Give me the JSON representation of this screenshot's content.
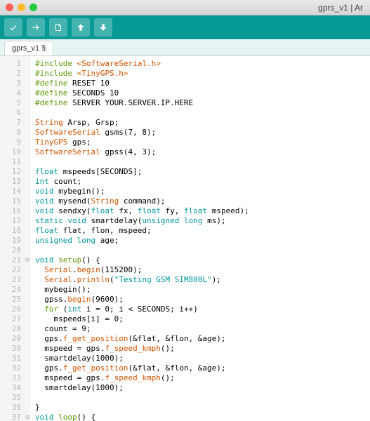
{
  "window": {
    "title": "gprs_v1 | Ar"
  },
  "toolbar": {
    "verify_icon": "verify",
    "upload_icon": "upload",
    "new_icon": "new",
    "open_icon": "open",
    "save_icon": "save"
  },
  "tab": {
    "label": "gprs_v1 §"
  },
  "lines": [
    {
      "n": "1",
      "fold": "",
      "segs": [
        {
          "c": "kw-green",
          "t": "#include"
        },
        {
          "c": "",
          "t": " "
        },
        {
          "c": "kw-orange",
          "t": "<SoftwareSerial.h>"
        }
      ]
    },
    {
      "n": "2",
      "fold": "",
      "segs": [
        {
          "c": "kw-green",
          "t": "#include"
        },
        {
          "c": "",
          "t": " "
        },
        {
          "c": "kw-orange",
          "t": "<TinyGPS.h>"
        }
      ]
    },
    {
      "n": "3",
      "fold": "",
      "segs": [
        {
          "c": "kw-green",
          "t": "#define"
        },
        {
          "c": "",
          "t": " RESET 10"
        }
      ]
    },
    {
      "n": "4",
      "fold": "",
      "segs": [
        {
          "c": "kw-green",
          "t": "#define"
        },
        {
          "c": "",
          "t": " SECONDS 10"
        }
      ]
    },
    {
      "n": "5",
      "fold": "",
      "segs": [
        {
          "c": "kw-green",
          "t": "#define"
        },
        {
          "c": "",
          "t": " SERVER YOUR.SERVER.IP.HERE"
        }
      ]
    },
    {
      "n": "6",
      "fold": "",
      "segs": [
        {
          "c": "",
          "t": ""
        }
      ]
    },
    {
      "n": "7",
      "fold": "",
      "segs": [
        {
          "c": "kw-orange",
          "t": "String"
        },
        {
          "c": "",
          "t": " Arsp, Grsp;"
        }
      ]
    },
    {
      "n": "8",
      "fold": "",
      "segs": [
        {
          "c": "kw-orange",
          "t": "SoftwareSerial"
        },
        {
          "c": "",
          "t": " gsms(7, 8);"
        }
      ]
    },
    {
      "n": "9",
      "fold": "",
      "segs": [
        {
          "c": "kw-orange",
          "t": "TinyGPS"
        },
        {
          "c": "",
          "t": " gps;"
        }
      ]
    },
    {
      "n": "10",
      "fold": "",
      "segs": [
        {
          "c": "kw-orange",
          "t": "SoftwareSerial"
        },
        {
          "c": "",
          "t": " gpss(4, 3);"
        }
      ]
    },
    {
      "n": "11",
      "fold": "",
      "segs": [
        {
          "c": "",
          "t": ""
        }
      ]
    },
    {
      "n": "12",
      "fold": "",
      "segs": [
        {
          "c": "kw-blue",
          "t": "float"
        },
        {
          "c": "",
          "t": " mspeeds[SECONDS];"
        }
      ]
    },
    {
      "n": "13",
      "fold": "",
      "segs": [
        {
          "c": "kw-blue",
          "t": "int"
        },
        {
          "c": "",
          "t": " count;"
        }
      ]
    },
    {
      "n": "14",
      "fold": "",
      "segs": [
        {
          "c": "kw-blue",
          "t": "void"
        },
        {
          "c": "",
          "t": " mybegin();"
        }
      ]
    },
    {
      "n": "15",
      "fold": "",
      "segs": [
        {
          "c": "kw-blue",
          "t": "void"
        },
        {
          "c": "",
          "t": " mysend("
        },
        {
          "c": "kw-orange",
          "t": "String"
        },
        {
          "c": "",
          "t": " command);"
        }
      ]
    },
    {
      "n": "16",
      "fold": "",
      "segs": [
        {
          "c": "kw-blue",
          "t": "void"
        },
        {
          "c": "",
          "t": " sendxy("
        },
        {
          "c": "kw-blue",
          "t": "float"
        },
        {
          "c": "",
          "t": " fx, "
        },
        {
          "c": "kw-blue",
          "t": "float"
        },
        {
          "c": "",
          "t": " fy, "
        },
        {
          "c": "kw-blue",
          "t": "float"
        },
        {
          "c": "",
          "t": " mspeed);"
        }
      ]
    },
    {
      "n": "17",
      "fold": "",
      "segs": [
        {
          "c": "kw-blue",
          "t": "static"
        },
        {
          "c": "",
          "t": " "
        },
        {
          "c": "kw-blue",
          "t": "void"
        },
        {
          "c": "",
          "t": " smartdelay("
        },
        {
          "c": "kw-blue",
          "t": "unsigned"
        },
        {
          "c": "",
          "t": " "
        },
        {
          "c": "kw-blue",
          "t": "long"
        },
        {
          "c": "",
          "t": " ms);"
        }
      ]
    },
    {
      "n": "18",
      "fold": "",
      "segs": [
        {
          "c": "kw-blue",
          "t": "float"
        },
        {
          "c": "",
          "t": " flat, flon, mspeed;"
        }
      ]
    },
    {
      "n": "19",
      "fold": "",
      "segs": [
        {
          "c": "kw-blue",
          "t": "unsigned"
        },
        {
          "c": "",
          "t": " "
        },
        {
          "c": "kw-blue",
          "t": "long"
        },
        {
          "c": "",
          "t": " age;"
        }
      ]
    },
    {
      "n": "20",
      "fold": "",
      "segs": [
        {
          "c": "",
          "t": ""
        }
      ]
    },
    {
      "n": "21",
      "fold": "⊟",
      "segs": [
        {
          "c": "kw-blue",
          "t": "void"
        },
        {
          "c": "",
          "t": " "
        },
        {
          "c": "kw-green",
          "t": "setup"
        },
        {
          "c": "",
          "t": "() {"
        }
      ]
    },
    {
      "n": "22",
      "fold": "",
      "segs": [
        {
          "c": "",
          "t": "  "
        },
        {
          "c": "kw-orange",
          "t": "Serial"
        },
        {
          "c": "",
          "t": "."
        },
        {
          "c": "kw-orange",
          "t": "begin"
        },
        {
          "c": "",
          "t": "(115200);"
        }
      ]
    },
    {
      "n": "23",
      "fold": "",
      "segs": [
        {
          "c": "",
          "t": "  "
        },
        {
          "c": "kw-orange",
          "t": "Serial"
        },
        {
          "c": "",
          "t": "."
        },
        {
          "c": "kw-orange",
          "t": "println"
        },
        {
          "c": "",
          "t": "("
        },
        {
          "c": "str",
          "t": "\"Testing GSM SIM800L\""
        },
        {
          "c": "",
          "t": ");"
        }
      ]
    },
    {
      "n": "24",
      "fold": "",
      "segs": [
        {
          "c": "",
          "t": "  mybegin();"
        }
      ]
    },
    {
      "n": "25",
      "fold": "",
      "segs": [
        {
          "c": "",
          "t": "  gpss."
        },
        {
          "c": "kw-orange",
          "t": "begin"
        },
        {
          "c": "",
          "t": "(9600);"
        }
      ]
    },
    {
      "n": "26",
      "fold": "",
      "segs": [
        {
          "c": "",
          "t": "  "
        },
        {
          "c": "kw-green",
          "t": "for"
        },
        {
          "c": "",
          "t": " ("
        },
        {
          "c": "kw-blue",
          "t": "int"
        },
        {
          "c": "",
          "t": " i = 0; i < SECONDS; i++)"
        }
      ]
    },
    {
      "n": "27",
      "fold": "",
      "segs": [
        {
          "c": "",
          "t": "    mspeeds[i] = 0;"
        }
      ]
    },
    {
      "n": "28",
      "fold": "",
      "segs": [
        {
          "c": "",
          "t": "  count = 9;"
        }
      ]
    },
    {
      "n": "29",
      "fold": "",
      "segs": [
        {
          "c": "",
          "t": "  gps."
        },
        {
          "c": "kw-orange",
          "t": "f_get_position"
        },
        {
          "c": "",
          "t": "(&flat, &flon, &age);"
        }
      ]
    },
    {
      "n": "30",
      "fold": "",
      "segs": [
        {
          "c": "",
          "t": "  mspeed = gps."
        },
        {
          "c": "kw-orange",
          "t": "f_speed_kmph"
        },
        {
          "c": "",
          "t": "();"
        }
      ]
    },
    {
      "n": "31",
      "fold": "",
      "segs": [
        {
          "c": "",
          "t": "  smartdelay(1000);"
        }
      ]
    },
    {
      "n": "32",
      "fold": "",
      "segs": [
        {
          "c": "",
          "t": "  gps."
        },
        {
          "c": "kw-orange",
          "t": "f_get_position"
        },
        {
          "c": "",
          "t": "(&flat, &flon, &age);"
        }
      ]
    },
    {
      "n": "33",
      "fold": "",
      "segs": [
        {
          "c": "",
          "t": "  mspeed = gps."
        },
        {
          "c": "kw-orange",
          "t": "f_speed_kmph"
        },
        {
          "c": "",
          "t": "();"
        }
      ]
    },
    {
      "n": "34",
      "fold": "",
      "segs": [
        {
          "c": "",
          "t": "  smartdelay(1000);"
        }
      ]
    },
    {
      "n": "35",
      "fold": "",
      "segs": [
        {
          "c": "",
          "t": ""
        }
      ]
    },
    {
      "n": "36",
      "fold": "",
      "segs": [
        {
          "c": "",
          "t": "}"
        }
      ]
    },
    {
      "n": "37",
      "fold": "⊟",
      "segs": [
        {
          "c": "kw-blue",
          "t": "void"
        },
        {
          "c": "",
          "t": " "
        },
        {
          "c": "kw-green",
          "t": "loop"
        },
        {
          "c": "",
          "t": "() {"
        }
      ]
    }
  ]
}
